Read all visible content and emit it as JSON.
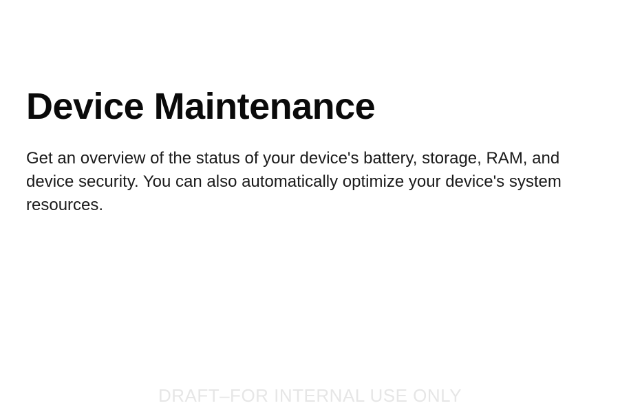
{
  "heading": "Device Maintenance",
  "description": "Get an overview of the status of your device's battery, storage, RAM, and device security. You can also automatically optimize your device's system resources.",
  "watermark": "DRAFT–FOR INTERNAL USE ONLY"
}
